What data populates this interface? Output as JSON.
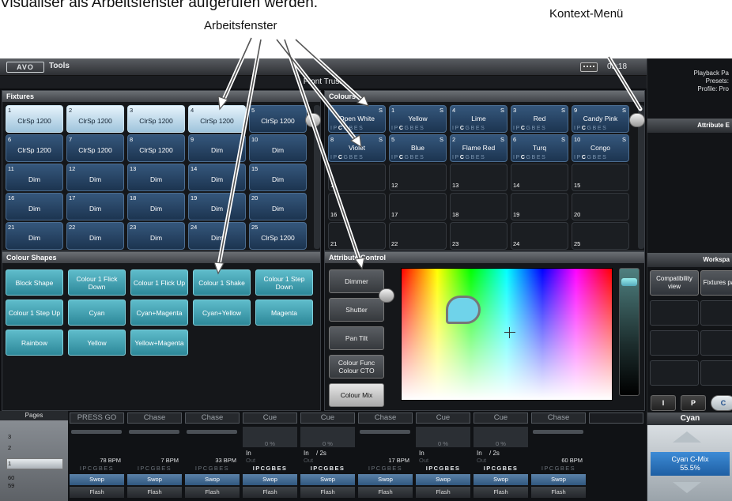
{
  "captions": {
    "top": "Visualiser als Arbeitsfenster aufgerufen werden.",
    "arbeitsfenster": "Arbeitsfenster",
    "kontext": "Kontext-Menü"
  },
  "titlebar": {
    "logo": "AVO",
    "tools": "Tools",
    "clock": "05:18"
  },
  "subtitle": "Front Truss",
  "fixtures": {
    "title": "Fixtures",
    "tiles": [
      {
        "num": "1",
        "label": "ClrSp 1200",
        "selected": true
      },
      {
        "num": "2",
        "label": "ClrSp 1200",
        "selected": true
      },
      {
        "num": "3",
        "label": "ClrSp 1200",
        "selected": true
      },
      {
        "num": "4",
        "label": "ClrSp 1200",
        "selected": true
      },
      {
        "num": "5",
        "label": "ClrSp 1200",
        "selected": false
      },
      {
        "num": "6",
        "label": "ClrSp 1200",
        "selected": false
      },
      {
        "num": "7",
        "label": "ClrSp 1200",
        "selected": false
      },
      {
        "num": "8",
        "label": "ClrSp 1200",
        "selected": false
      },
      {
        "num": "9",
        "label": "Dim",
        "selected": false
      },
      {
        "num": "10",
        "label": "Dim",
        "selected": false
      },
      {
        "num": "11",
        "label": "Dim",
        "selected": false
      },
      {
        "num": "12",
        "label": "Dim",
        "selected": false
      },
      {
        "num": "13",
        "label": "Dim",
        "selected": false
      },
      {
        "num": "14",
        "label": "Dim",
        "selected": false
      },
      {
        "num": "15",
        "label": "Dim",
        "selected": false
      },
      {
        "num": "16",
        "label": "Dim",
        "selected": false
      },
      {
        "num": "17",
        "label": "Dim",
        "selected": false
      },
      {
        "num": "18",
        "label": "Dim",
        "selected": false
      },
      {
        "num": "19",
        "label": "Dim",
        "selected": false
      },
      {
        "num": "20",
        "label": "Dim",
        "selected": false
      },
      {
        "num": "21",
        "label": "Dim",
        "selected": false
      },
      {
        "num": "22",
        "label": "Dim",
        "selected": false
      },
      {
        "num": "23",
        "label": "Dim",
        "selected": false
      },
      {
        "num": "24",
        "label": "Dim",
        "selected": false
      },
      {
        "num": "25",
        "label": "ClrSp 1200",
        "selected": false
      }
    ]
  },
  "colours": {
    "title": "Colours",
    "ipc": "IPCGBES",
    "tiles": [
      {
        "num": "7",
        "s": "S",
        "label": "Open White",
        "filled": true
      },
      {
        "num": "1",
        "s": "S",
        "label": "Yellow",
        "filled": true
      },
      {
        "num": "4",
        "s": "S",
        "label": "Lime",
        "filled": true
      },
      {
        "num": "3",
        "s": "S",
        "label": "Red",
        "filled": true
      },
      {
        "num": "9",
        "s": "S",
        "label": "Candy Pink",
        "filled": true
      },
      {
        "num": "8",
        "s": "S",
        "label": "Violet",
        "filled": true
      },
      {
        "num": "5",
        "s": "S",
        "label": "Blue",
        "filled": true
      },
      {
        "num": "2",
        "s": "S",
        "label": "Flame Red",
        "filled": true
      },
      {
        "num": "6",
        "s": "S",
        "label": "Turq",
        "filled": true
      },
      {
        "num": "10",
        "s": "S",
        "label": "Congo",
        "filled": true
      },
      {
        "num": "11",
        "s": "",
        "label": "",
        "filled": false
      },
      {
        "num": "12",
        "s": "",
        "label": "",
        "filled": false
      },
      {
        "num": "13",
        "s": "",
        "label": "",
        "filled": false
      },
      {
        "num": "14",
        "s": "",
        "label": "",
        "filled": false
      },
      {
        "num": "15",
        "s": "",
        "label": "",
        "filled": false
      },
      {
        "num": "16",
        "s": "",
        "label": "",
        "filled": false
      },
      {
        "num": "17",
        "s": "",
        "label": "",
        "filled": false
      },
      {
        "num": "18",
        "s": "",
        "label": "",
        "filled": false
      },
      {
        "num": "19",
        "s": "",
        "label": "",
        "filled": false
      },
      {
        "num": "20",
        "s": "",
        "label": "",
        "filled": false
      },
      {
        "num": "21",
        "s": "",
        "label": "",
        "filled": false
      },
      {
        "num": "22",
        "s": "",
        "label": "",
        "filled": false
      },
      {
        "num": "23",
        "s": "",
        "label": "",
        "filled": false
      },
      {
        "num": "24",
        "s": "",
        "label": "",
        "filled": false
      },
      {
        "num": "25",
        "s": "",
        "label": "",
        "filled": false
      }
    ]
  },
  "shapes": {
    "title": "Colour Shapes",
    "tiles": [
      "Block Shape",
      "Colour 1 Flick Down",
      "Colour 1 Flick Up",
      "Colour 1 Shake",
      "Colour 1 Step Down",
      "Colour 1 Step Up",
      "Cyan",
      "Cyan+Magenta",
      "Cyan+Yellow",
      "Magenta",
      "Rainbow",
      "Yellow",
      "Yellow+Magenta"
    ]
  },
  "attribute": {
    "title": "Attribute Control",
    "buttons": [
      {
        "label": "Dimmer",
        "active": false
      },
      {
        "label": "Shutter",
        "active": false
      },
      {
        "label": "Pan Tilt",
        "active": false
      },
      {
        "label": "Colour Func Colour CTO",
        "active": false
      },
      {
        "label": "Colour Mix",
        "active": true
      }
    ],
    "picker_color": "#6fd3ea"
  },
  "right": {
    "playback_lines": [
      "Playback Pa",
      "Presets:",
      "Profile: Pro"
    ],
    "attribute_editor": "Attribute E",
    "workspace": "Workspa",
    "workspace_buttons": [
      "Compatibility view",
      "Fixtures palette"
    ],
    "ipc_buttons": [
      "I",
      "P",
      "C"
    ],
    "encoder_name": "Cyan",
    "encoder_value_label": "Cyan C-Mix",
    "encoder_value": "55.5%"
  },
  "pages": {
    "title": "Pages",
    "numbers": [
      "3",
      "2",
      "1",
      "60",
      "59"
    ]
  },
  "playbacks": [
    {
      "label": "PRESS GO",
      "kind": "bar",
      "pct": "",
      "in": "",
      "sub": "",
      "out": "",
      "bpm": "78 BPM",
      "ipc_bright": false
    },
    {
      "label": "Chase",
      "kind": "bar",
      "pct": "",
      "in": "",
      "sub": "",
      "out": "",
      "bpm": "7 BPM",
      "ipc_bright": false
    },
    {
      "label": "Chase",
      "kind": "bar",
      "pct": "",
      "in": "",
      "sub": "",
      "out": "",
      "bpm": "33 BPM",
      "ipc_bright": false
    },
    {
      "label": "Cue",
      "kind": "box",
      "pct": "0 %",
      "in": "In",
      "sub": "",
      "out": "Out",
      "bpm": "",
      "ipc_bright": true
    },
    {
      "label": "Cue",
      "kind": "box",
      "pct": "0 %",
      "in": "In",
      "sub": "/ 2s",
      "out": "Out",
      "bpm": "",
      "ipc_bright": true
    },
    {
      "label": "Chase",
      "kind": "bar",
      "pct": "",
      "in": "",
      "sub": "",
      "out": "",
      "bpm": "17 BPM",
      "ipc_bright": false
    },
    {
      "label": "Cue",
      "kind": "box",
      "pct": "0 %",
      "in": "In",
      "sub": "",
      "out": "Out",
      "bpm": "",
      "ipc_bright": true
    },
    {
      "label": "Cue",
      "kind": "box",
      "pct": "0 %",
      "in": "In",
      "sub": "/ 2s",
      "out": "Out",
      "bpm": "",
      "ipc_bright": true
    },
    {
      "label": "Chase",
      "kind": "bar",
      "pct": "",
      "in": "",
      "sub": "",
      "out": "",
      "bpm": "60 BPM",
      "ipc_bright": false
    },
    {
      "label": "",
      "kind": "none",
      "pct": "",
      "in": "",
      "sub": "",
      "out": "",
      "bpm": "",
      "ipc_bright": false
    }
  ],
  "pb_common": {
    "ipc": "IPCGBES",
    "swop": "Swop",
    "flash": "Flash"
  }
}
